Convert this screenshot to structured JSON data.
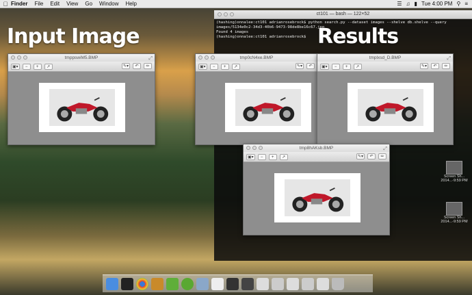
{
  "menubar": {
    "items": [
      "Finder",
      "File",
      "Edit",
      "View",
      "Go",
      "Window",
      "Help"
    ],
    "clock": "Tue 4:00 PM"
  },
  "overlays": {
    "input_title": "Input Image",
    "results_title": "Results"
  },
  "terminal": {
    "title": "ct101 — bash — 122×52",
    "lines": [
      "(hashing)onnalee:ct101 adrianrosebrock$ python search.py --dataset images --shelve db.shelve --query images/5134e0c2-34d3-40b6-9473-98de8be16c67.jpg",
      "Found 4 images",
      "(hashing)onnalee:ct101 adrianrosebrock$"
    ]
  },
  "windows": [
    {
      "title": "tmppswiM5.BMP"
    },
    {
      "title": "tmp0cN4xe.BMP"
    },
    {
      "title": "tmplxsd_D.BMP"
    },
    {
      "title": "tmp8hAKsb.BMP"
    }
  ],
  "desktop_files": [
    {
      "label": "Screen Sh... 2014...-9:59 PM"
    },
    {
      "label": "Screen Sh... 2014...-9:59 PM"
    }
  ],
  "dock": {
    "icons": [
      "finder-icon",
      "terminal-icon",
      "chrome-icon",
      "filemerge-icon",
      "evernote-icon",
      "spotify-icon",
      "preview-icon",
      "textedit-icon",
      "window-icon",
      "window-icon",
      "window-icon",
      "window-icon",
      "window-icon",
      "window-icon",
      "window-icon",
      "trash-icon"
    ]
  }
}
